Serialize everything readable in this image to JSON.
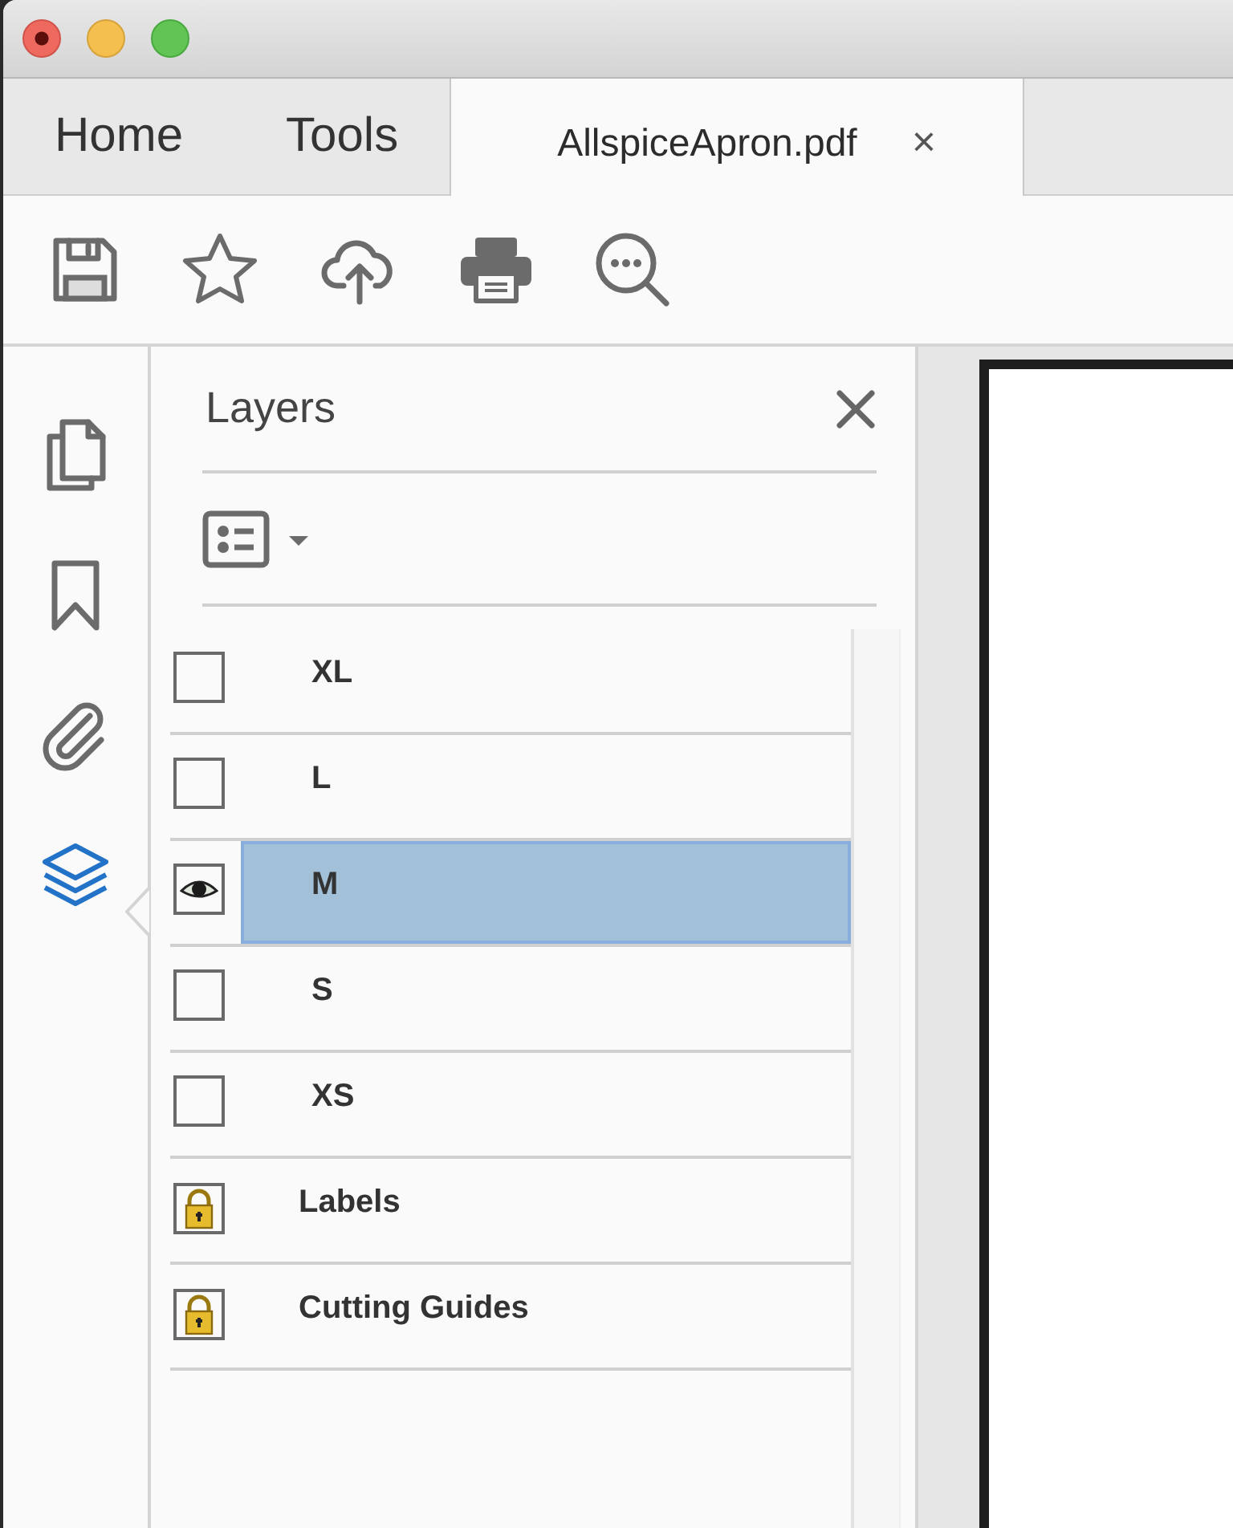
{
  "tabs": [
    {
      "label": "Home",
      "selected": false
    },
    {
      "label": "Tools",
      "selected": false
    },
    {
      "label": "AllspiceApron.pdf",
      "selected": true,
      "close": "×"
    }
  ],
  "panel": {
    "title": "Layers"
  },
  "layers": [
    {
      "name": "XL",
      "kind": "toggle",
      "visible": false,
      "selected": false
    },
    {
      "name": "L",
      "kind": "toggle",
      "visible": false,
      "selected": false
    },
    {
      "name": "M",
      "kind": "toggle",
      "visible": true,
      "selected": true
    },
    {
      "name": "S",
      "kind": "toggle",
      "visible": false,
      "selected": false
    },
    {
      "name": "XS",
      "kind": "toggle",
      "visible": false,
      "selected": false
    },
    {
      "name": "Labels",
      "kind": "locked",
      "selected": false
    },
    {
      "name": "Cutting Guides",
      "kind": "locked",
      "selected": false
    }
  ]
}
